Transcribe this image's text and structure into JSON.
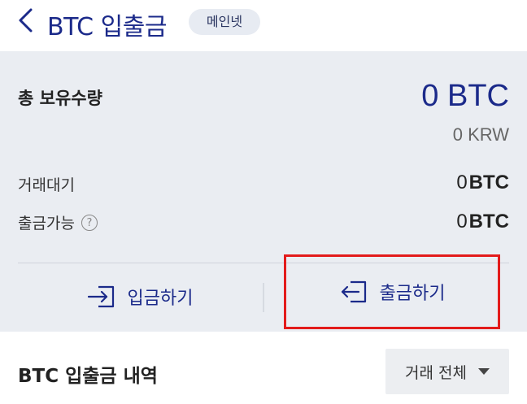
{
  "header": {
    "title": "BTC 입출금",
    "network_badge": "메인넷"
  },
  "balance": {
    "total_label": "총 보유수량",
    "total_btc": "0 BTC",
    "total_krw": "0 KRW",
    "pending_label": "거래대기",
    "pending_value": "0",
    "pending_unit": "BTC",
    "withdrawable_label": "출금가능",
    "withdrawable_value": "0",
    "withdrawable_unit": "BTC",
    "help_symbol": "?"
  },
  "actions": {
    "deposit_label": "입금하기",
    "withdraw_label": "출금하기"
  },
  "history": {
    "title": "BTC 입출금 내역",
    "filter_label": "거래 전체"
  },
  "colors": {
    "accent": "#1b2a8a",
    "highlight": "#e31b1b",
    "panel_bg": "#eaedf2"
  }
}
